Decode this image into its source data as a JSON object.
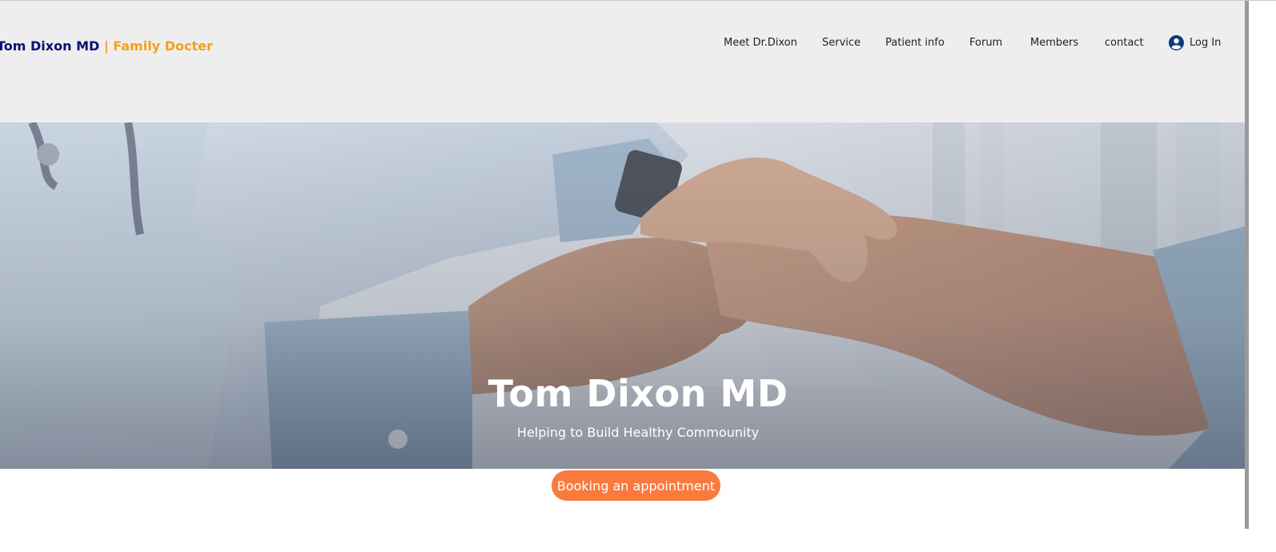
{
  "header": {
    "brand_name": "Tom Dixon MD",
    "brand_separator": "|",
    "brand_tagline": "Family Docter",
    "nav": [
      {
        "label": "Meet Dr.Dixon"
      },
      {
        "label": "Service"
      },
      {
        "label": "Patient info"
      },
      {
        "label": "Forum"
      },
      {
        "label": "Members"
      },
      {
        "label": "contact"
      }
    ],
    "login_label": "Log In",
    "login_icon": "user-circle-icon"
  },
  "hero": {
    "title": "Tom Dixon MD",
    "subtitle": "Helping to Build Healthy Commounity",
    "image": "doctor-holding-patient-hands-photo"
  },
  "cta": {
    "label": "Booking an appointment"
  },
  "colors": {
    "header_bg": "#eeeeee",
    "brand_name": "#0a1173",
    "brand_accent": "#f3a11a",
    "cta_bg": "#fa7a3e",
    "text": "#222222"
  }
}
